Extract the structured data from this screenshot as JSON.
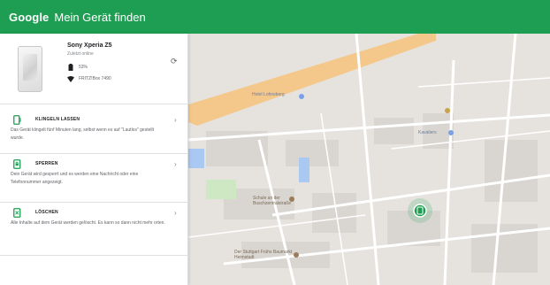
{
  "header": {
    "brand": "Google",
    "title": "Mein Gerät finden"
  },
  "device": {
    "name": "Sony Xperia Z5",
    "status": "Zuletzt online",
    "battery": "53%",
    "network": "FRITZ!Box 7490",
    "icons": {
      "battery": "battery-icon",
      "wifi": "wifi-icon",
      "refresh": "refresh-icon"
    }
  },
  "actions": [
    {
      "label": "KLINGELN LASSEN",
      "description": "Das Gerät klingelt fünf Minuten lang, selbst wenn es auf \"Lautlos\" gestellt wurde.",
      "icon": "ring-phone-icon"
    },
    {
      "label": "SPERREN",
      "description": "Dein Gerät wird gesperrt und es werden eine Nachricht oder eine Telefonnummer angezeigt.",
      "icon": "lock-phone-icon"
    },
    {
      "label": "LÖSCHEN",
      "description": "Alle Inhalte auf dem Gerät werden gelöscht. Es kann so dann nicht mehr orten.",
      "icon": "erase-phone-icon"
    }
  ],
  "map": {
    "places": [
      {
        "label": "Hotel Lohnsberg"
      },
      {
        "label": "Schule an der Buschzentralstraße"
      },
      {
        "label": "Kavaliers"
      },
      {
        "label": "Der Stuttgart Frühs Baumarkt Heimstadt"
      }
    ],
    "colors": {
      "background": "#e6e3df",
      "highway": "#f4c88a",
      "water": "#a9c8f2",
      "park": "#cfe8c4",
      "marker": "#1e9e52"
    }
  },
  "theme": {
    "accent": "#1e9e52"
  }
}
